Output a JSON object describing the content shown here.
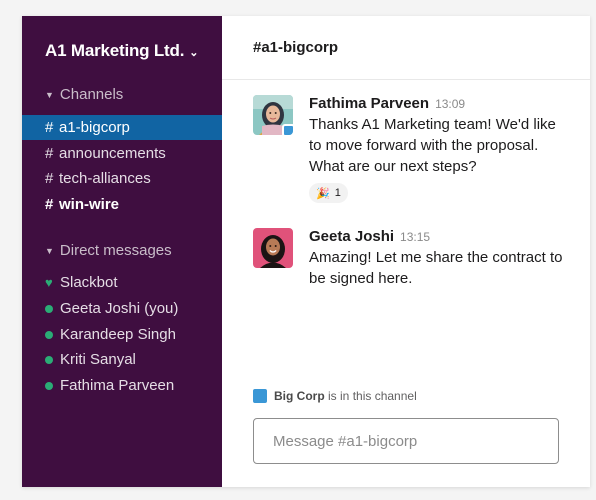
{
  "workspace": {
    "name": "A1 Marketing Ltd."
  },
  "sidebar": {
    "channels_label": "Channels",
    "channels": [
      {
        "hash": "#",
        "name": "a1-bigcorp"
      },
      {
        "hash": "#",
        "name": "announcements"
      },
      {
        "hash": "#",
        "name": "tech-alliances"
      },
      {
        "hash": "#",
        "name": "win-wire"
      }
    ],
    "dm_label": "Direct messages",
    "dms": [
      {
        "name": "Slackbot"
      },
      {
        "name": "Geeta Joshi (you)"
      },
      {
        "name": "Karandeep Singh"
      },
      {
        "name": "Kriti Sanyal"
      },
      {
        "name": "Fathima Parveen"
      }
    ]
  },
  "channel": {
    "title": "#a1-bigcorp"
  },
  "messages": [
    {
      "sender": "Fathima Parveen",
      "time": "13:09",
      "text": "Thanks A1 Marketing team! We'd like to move forward with the proposal. What are our next steps?",
      "reaction": {
        "emoji": "🎉",
        "count": "1"
      }
    },
    {
      "sender": "Geeta Joshi",
      "time": "13:15",
      "text": "Amazing! Let me share the contract to be signed here."
    }
  ],
  "external": {
    "org": "Big Corp",
    "suffix": "is in this channel"
  },
  "composer": {
    "placeholder": "Message #a1-bigcorp"
  },
  "colors": {
    "sidebar_bg": "#3f0e40",
    "active_item": "#1164a3",
    "presence": "#2bac76",
    "external_badge": "#3a97d6"
  }
}
